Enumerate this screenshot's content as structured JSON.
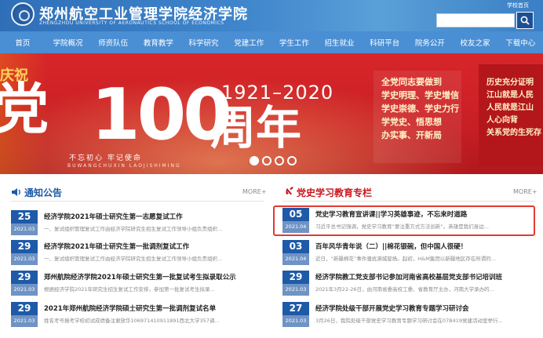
{
  "header": {
    "school_name": "郑州航空工业管理学院经济学院",
    "school_name_en": "ZHENGZHOU UNIVERSITY OF AERONAUTICS  SCHOOL OF ECONOMICS",
    "top_link": "学校首页",
    "search_placeholder": ""
  },
  "nav": [
    "首页",
    "学院概况",
    "师资队伍",
    "教育教学",
    "科学研究",
    "党建工作",
    "学生工作",
    "招生就业",
    "科研平台",
    "院务公开",
    "校友之家",
    "下载中心"
  ],
  "banner": {
    "left_fragment_top": "庆祝",
    "left_fragment_big": "党",
    "years": "1921–2020",
    "big_number": "100",
    "big_suffix": "周年",
    "slogan": "不忘初心  牢记使命",
    "slogan_en": "BUWANGCHUXIN  LAOJISHIMING",
    "panel_lines": [
      "全党同志要做到",
      "学史明理、学史增信",
      "学史崇德、学史力行",
      "学党史、悟思想",
      "办实事、开新局"
    ],
    "right_lines": [
      "历史充分证明",
      "江山就是人民",
      "人民就是江山",
      "人心向背",
      "关系党的生死存"
    ],
    "slides": 4,
    "active_slide": 1
  },
  "notice": {
    "title": "通知公告",
    "more": "MORE+",
    "items": [
      {
        "day": "25",
        "ym": "2021.03",
        "title": "经济学院2021年硕士研究生第一志愿复试工作",
        "summary": "一、复试组织管理复试工作由经济学院研究生招生复试工作领导小组负责组织..."
      },
      {
        "day": "29",
        "ym": "2021.03",
        "title": "经济学院2021年硕士研究生第一批调剂复试工作",
        "summary": "一、复试组织管理复试工作由经济学院研究生招生复试工作领导小组负责组织..."
      },
      {
        "day": "29",
        "ym": "2021.03",
        "title": "郑州航院经济学院2021年硕士研究生第一批复试考生拟录取公示",
        "summary": "根据经济学院2021年研究生招生复试工作安排，参加第一批复试考生拟录..."
      },
      {
        "day": "29",
        "ym": "2021.03",
        "title": "2021年郑州航院经济学院硕士研究生第一批调剂复试名单",
        "summary": "姓名考号报考学校初试成绩备注谢放华106971410911891西北大学357调..."
      }
    ]
  },
  "party": {
    "title": "党史学习教育专栏",
    "more": "MORE+",
    "items": [
      {
        "day": "05",
        "ym": "2021.04",
        "title": "党史学习教育宣讲课||学习英雄事迹，不忘来时道路",
        "summary": "习近平总书记强调，党史学习教育“要注重方式方法创新”。英雄是我们身边..."
      },
      {
        "day": "03",
        "ym": "2021.04",
        "title": "百年风华青年说（二）||棉花银碗，但中国人很硬！",
        "summary": "近日，“新疆棉花”事件骚扰满城旋扬。起初，H&M集团以新疆地区存在所谓的..."
      },
      {
        "day": "29",
        "ym": "2021.03",
        "title": "经济学院教工党支部书记参加河南省高校基层党支部书记培训班",
        "summary": "2021年3月22-26日，由河南省委高校工委、省教育厅主办，河南大学承办的..."
      },
      {
        "day": "27",
        "ym": "2021.03",
        "title": "经济学院处级干部开展党史学习教育专题学习研讨会",
        "summary": "3月26日，我院处级干部党史学习教育专题学习研讨会在07B419党建活动室举行..."
      }
    ]
  },
  "colors": {
    "primary": "#1e5aa8",
    "nav": "#4a8ed3",
    "banner_red": "#c81f24",
    "highlight": "#e23a33"
  }
}
